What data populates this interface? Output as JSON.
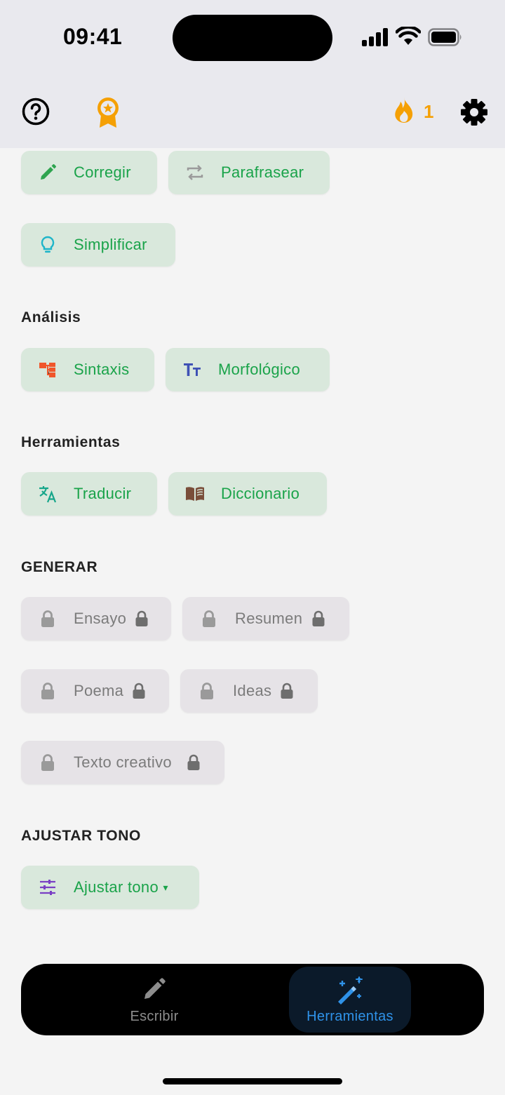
{
  "status_bar": {
    "time": "09:41"
  },
  "header": {
    "help_icon": "help-circle-icon",
    "award_icon": "award-badge-icon",
    "streak_icon": "flame-icon",
    "streak_count": "1",
    "settings_icon": "gear-icon",
    "accent_color": "#f5a005"
  },
  "edit_tools": [
    {
      "label": "Corregir",
      "icon": "pencil-icon"
    },
    {
      "label": "Parafrasear",
      "icon": "repeat-icon"
    },
    {
      "label": "Simplificar",
      "icon": "lightbulb-icon"
    }
  ],
  "analysis": {
    "title": "Análisis",
    "items": [
      {
        "label": "Sintaxis",
        "icon": "tree-structure-icon"
      },
      {
        "label": "Morfológico",
        "icon": "text-size-icon"
      }
    ]
  },
  "tools": {
    "title": "Herramientas",
    "items": [
      {
        "label": "Traducir",
        "icon": "translate-icon"
      },
      {
        "label": "Diccionario",
        "icon": "book-icon"
      }
    ]
  },
  "generate": {
    "title": "GENERAR",
    "items": [
      {
        "label": "Ensayo",
        "locked": true
      },
      {
        "label": "Resumen",
        "locked": true
      },
      {
        "label": "Poema",
        "locked": true
      },
      {
        "label": "Ideas",
        "locked": true
      },
      {
        "label": "Texto creativo",
        "locked": true
      }
    ]
  },
  "tone": {
    "title": "AJUSTAR TONO",
    "button_label": "Ajustar tono",
    "caret": "▾",
    "icon": "sliders-icon"
  },
  "bottom_nav": {
    "items": [
      {
        "label": "Escribir",
        "icon": "pencil-icon",
        "active": false
      },
      {
        "label": "Herramientas",
        "icon": "magic-wand-icon",
        "active": true
      }
    ]
  },
  "colors": {
    "chip_bg": "#d9e8dc",
    "chip_text": "#1aa34a",
    "locked_bg": "#e6e3e7",
    "nav_active": "#2f92e8"
  }
}
